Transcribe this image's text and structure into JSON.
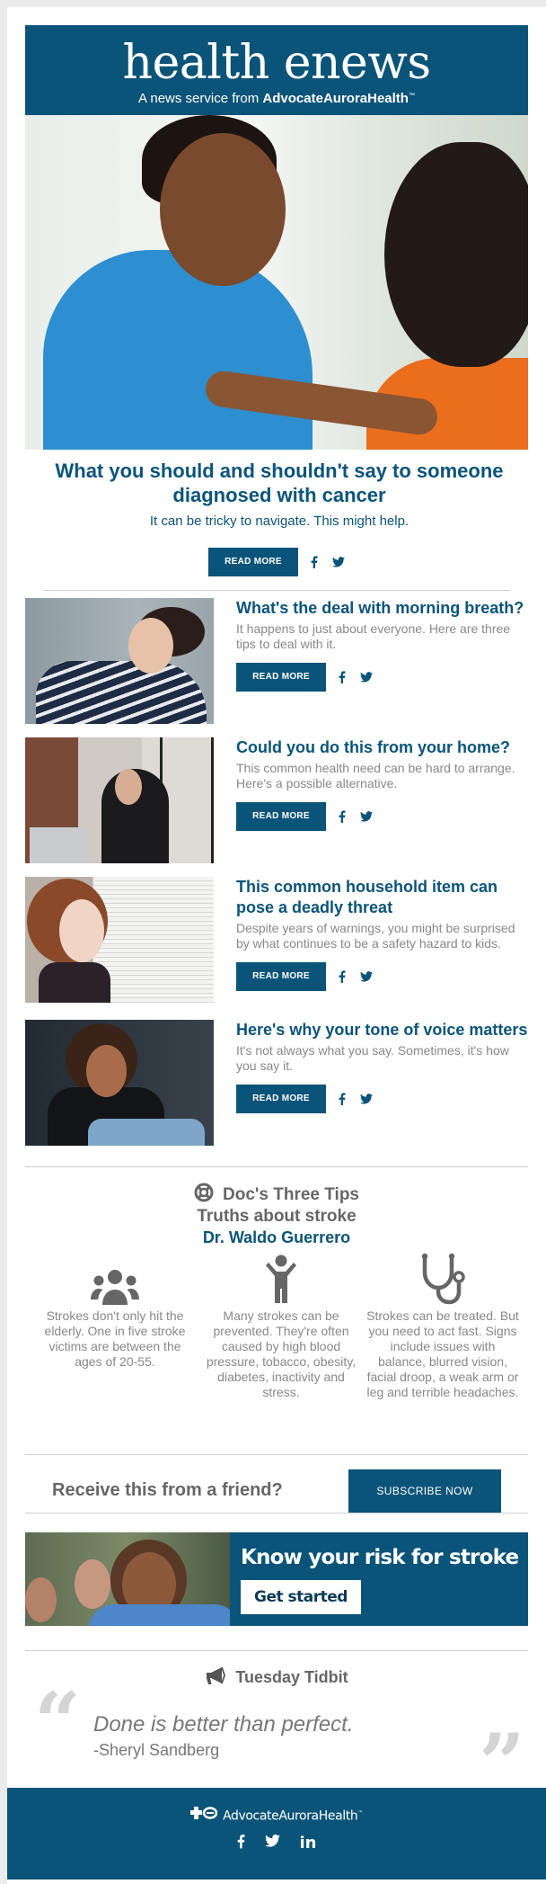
{
  "masthead": {
    "logo": "health enews",
    "tagline_prefix": "A news service from",
    "tagline_brand": "AdvocateAuroraHealth",
    "tagline_tm": "™"
  },
  "colors": {
    "brand_blue": "#0b5479",
    "text_gray": "#888888",
    "heading_gray": "#666666"
  },
  "hero": {
    "image_alt": "Nurse in blue scrubs comforting a patient",
    "title": "What you should and shouldn't say to someone diagnosed with cancer",
    "subtitle": "It can be tricky to navigate. This might help.",
    "read_more": "READ MORE",
    "facebook_icon": "facebook-icon",
    "twitter_icon": "twitter-icon"
  },
  "articles": [
    {
      "image_alt": "Woman yawning",
      "title": "What's the deal with morning breath?",
      "description": "It happens to just about everyone. Here are three tips to deal with it.",
      "read_more": "READ MORE"
    },
    {
      "image_alt": "Woman sitting at laptop at home",
      "title": "Could you do this from your home?",
      "description": "This common health need can be hard to arrange. Here's a possible alternative.",
      "read_more": "READ MORE"
    },
    {
      "image_alt": "Toddler looking out window blinds",
      "title": "This common household item can pose a deadly threat",
      "description": "Despite years of warnings, you might be surprised by what continues to be a safety hazard to kids.",
      "read_more": "READ MORE"
    },
    {
      "image_alt": "Upset young woman sitting on floor",
      "title": "Here's why your tone of voice matters",
      "description": "It's not always what you say. Sometimes, it's how you say it.",
      "read_more": "READ MORE"
    }
  ],
  "tips": {
    "heading": "Doc's Three Tips",
    "heading_icon": "life-ring-icon",
    "topic": "Truths about stroke",
    "doctor": "Dr. Waldo Guerrero",
    "items": [
      {
        "icon": "group-icon",
        "text": "Strokes don't only hit the elderly. One in five stroke victims are between the ages of 20-55."
      },
      {
        "icon": "person-icon",
        "text": "Many strokes can be prevented. They're often caused by high blood pressure, tobacco, obesity, diabetes, inactivity and stress."
      },
      {
        "icon": "stethoscope-icon",
        "text": "Strokes can be treated. But you need to act fast. Signs include issues with balance, blurred vision, facial droop, a weak arm or leg and terrible headaches."
      }
    ]
  },
  "subscribe": {
    "prompt": "Receive this from a friend?",
    "button": "SUBSCRIBE NOW"
  },
  "promo": {
    "image_alt": "Smiling woman with friends outdoors",
    "title": "Know your risk for stroke",
    "button": "Get started"
  },
  "tidbit": {
    "heading": "Tuesday Tidbit",
    "heading_icon": "megaphone-icon",
    "open_quote": "“",
    "close_quote": "”",
    "quote": "Done is better than perfect.",
    "author": "-Sheryl Sandberg"
  },
  "footer": {
    "brand": "AdvocateAuroraHealth",
    "tm": "™",
    "social": [
      "facebook-icon",
      "twitter-icon",
      "linkedin-icon"
    ],
    "linkedin_label": "in"
  }
}
